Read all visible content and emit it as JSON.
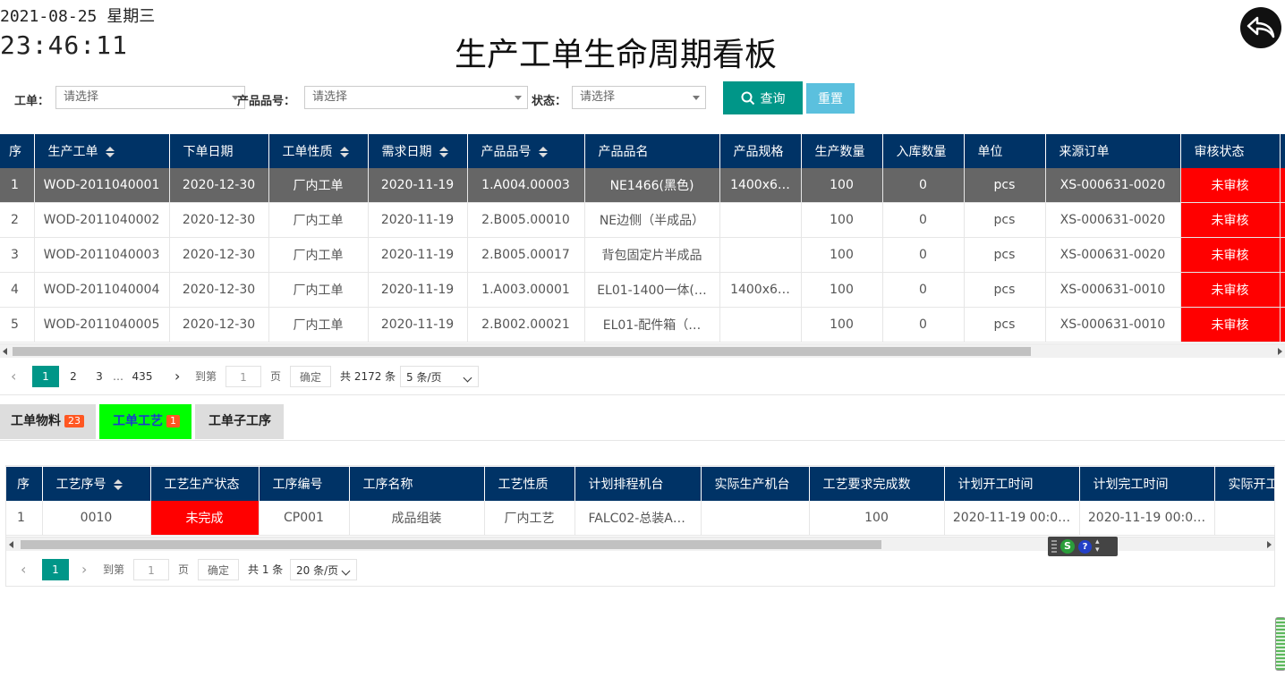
{
  "header": {
    "date": "2021-08-25 星期三",
    "time": "23:46:11",
    "title": "生产工单生命周期看板"
  },
  "filters": {
    "workorder_label": "工单：",
    "workorder_placeholder": "请选择",
    "product_label": "产品品号：",
    "product_placeholder": "请选择",
    "status_label": "状态：",
    "status_placeholder": "请选择",
    "query_label": "查询",
    "reset_label": "重置"
  },
  "main_table": {
    "columns": [
      "序",
      "生产工单",
      "下单日期",
      "工单性质",
      "需求日期",
      "产品品号",
      "产品品名",
      "产品规格",
      "生产数量",
      "入库数量",
      "单位",
      "来源订单",
      "审核状态"
    ],
    "rows": [
      [
        "1",
        "WOD-2011040001",
        "2020-12-30",
        "厂内工单",
        "2020-11-19",
        "1.A004.00003",
        "NE1466(黑色)",
        "1400x6…",
        "100",
        "0",
        "pcs",
        "XS-000631-0020",
        "未审核"
      ],
      [
        "2",
        "WOD-2011040002",
        "2020-12-30",
        "厂内工单",
        "2020-11-19",
        "2.B005.00010",
        "NE边侧（半成品）",
        "",
        "100",
        "0",
        "pcs",
        "XS-000631-0020",
        "未审核"
      ],
      [
        "3",
        "WOD-2011040003",
        "2020-12-30",
        "厂内工单",
        "2020-11-19",
        "2.B005.00017",
        "背包固定片半成品",
        "",
        "100",
        "0",
        "pcs",
        "XS-000631-0020",
        "未审核"
      ],
      [
        "4",
        "WOD-2011040004",
        "2020-12-30",
        "厂内工单",
        "2020-11-19",
        "1.A003.00001",
        "EL01-1400一体(…",
        "1400x6…",
        "100",
        "0",
        "pcs",
        "XS-000631-0010",
        "未审核"
      ],
      [
        "5",
        "WOD-2011040005",
        "2020-12-30",
        "厂内工单",
        "2020-11-19",
        "2.B002.00021",
        "EL01-配件箱（…",
        "",
        "100",
        "0",
        "pcs",
        "XS-000631-0010",
        "未审核"
      ]
    ]
  },
  "main_pager": {
    "pages": [
      "1",
      "2",
      "3"
    ],
    "ellipsis": "…",
    "last_page": "435",
    "goto_label": "到第",
    "goto_value": "1",
    "page_unit": "页",
    "confirm_label": "确定",
    "total_label": "共 2172 条",
    "page_size": "5 条/页"
  },
  "tabs": [
    {
      "label": "工单物料",
      "badge": "23"
    },
    {
      "label": "工单工艺",
      "badge": "1"
    },
    {
      "label": "工单子工序",
      "badge": ""
    }
  ],
  "process_table": {
    "columns": [
      "序",
      "工艺序号",
      "工艺生产状态",
      "工序编号",
      "工序名称",
      "工艺性质",
      "计划排程机台",
      "实际生产机台",
      "工艺要求完成数",
      "计划开工时间",
      "计划完工时间",
      "实际开工"
    ],
    "rows": [
      [
        "1",
        "0010",
        "未完成",
        "CP001",
        "成品组装",
        "厂内工艺",
        "FALC02-总装A…",
        "",
        "100",
        "2020-11-19 00:0…",
        "2020-11-19 00:0…",
        ""
      ]
    ]
  },
  "process_pager": {
    "page": "1",
    "goto_label": "到第",
    "goto_value": "1",
    "page_unit": "页",
    "confirm_label": "确定",
    "total_label": "共 1 条",
    "page_size": "20 条/页"
  },
  "colors": {
    "header_bg": "#003366",
    "accent": "#009688",
    "reset": "#5bc0de",
    "unreviewed": "#ff0000",
    "selected_row": "#666666",
    "active_tab": "#00ff00"
  }
}
